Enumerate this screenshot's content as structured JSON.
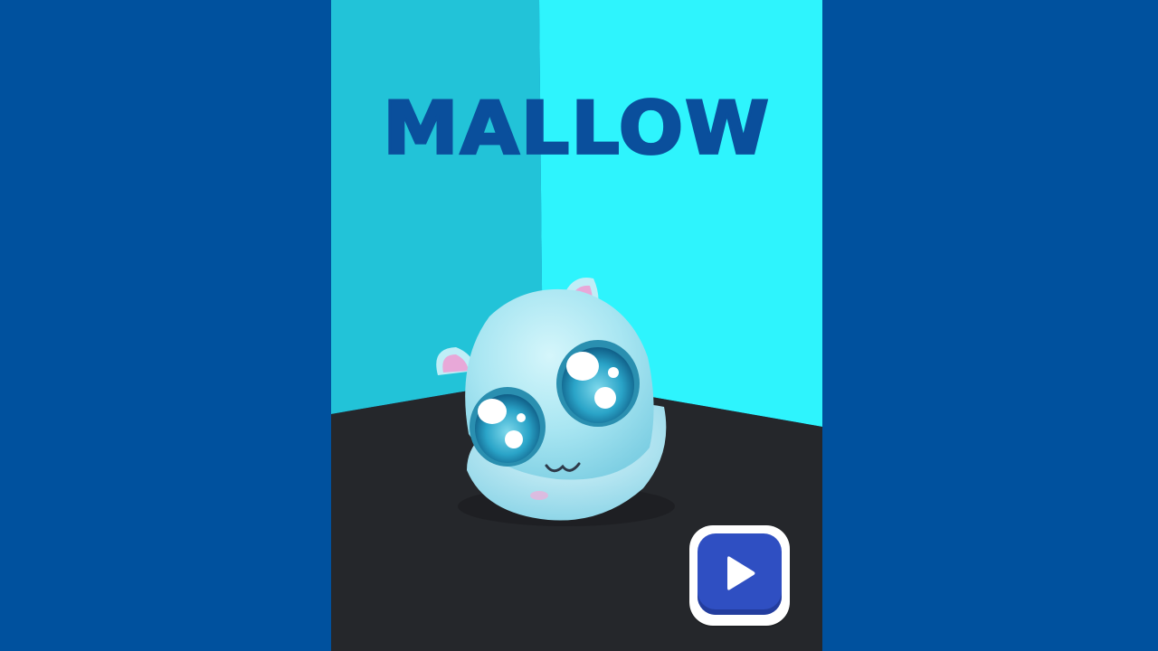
{
  "game": {
    "character_name": "MALLOW"
  },
  "controls": {
    "play_icon": "play-icon"
  },
  "colors": {
    "page_background": "#00519e",
    "wall_left": "#22c3d8",
    "wall_right": "#2ef4fd",
    "floor": "#25272b",
    "title_text": "#0a4f9c",
    "button_face": "#2f4fc2",
    "button_border": "#ffffff",
    "character_body": "#a9e6f2",
    "character_ear_inner": "#e8a8d8"
  }
}
